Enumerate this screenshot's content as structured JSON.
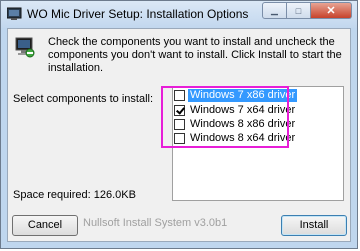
{
  "window": {
    "title": "WO Mic Driver Setup: Installation Options"
  },
  "header": {
    "instructions": "Check the components you want to install and uncheck the components you don't want to install. Click Install to start the installation."
  },
  "components": {
    "label": "Select components to install:",
    "items": [
      {
        "label": "Windows 7 x86 driver",
        "checked": false,
        "selected": true
      },
      {
        "label": "Windows 7 x64 driver",
        "checked": true,
        "selected": false
      },
      {
        "label": "Windows 8 x86 driver",
        "checked": false,
        "selected": false
      },
      {
        "label": "Windows 8 x64 driver",
        "checked": false,
        "selected": false
      }
    ]
  },
  "space_required": "Space required: 126.0KB",
  "footer": {
    "cancel_label": "Cancel",
    "branding": "Nullsoft Install System v3.0b1",
    "install_label": "Install"
  },
  "colors": {
    "highlight": "#e71ed8",
    "selection": "#3399ff"
  }
}
